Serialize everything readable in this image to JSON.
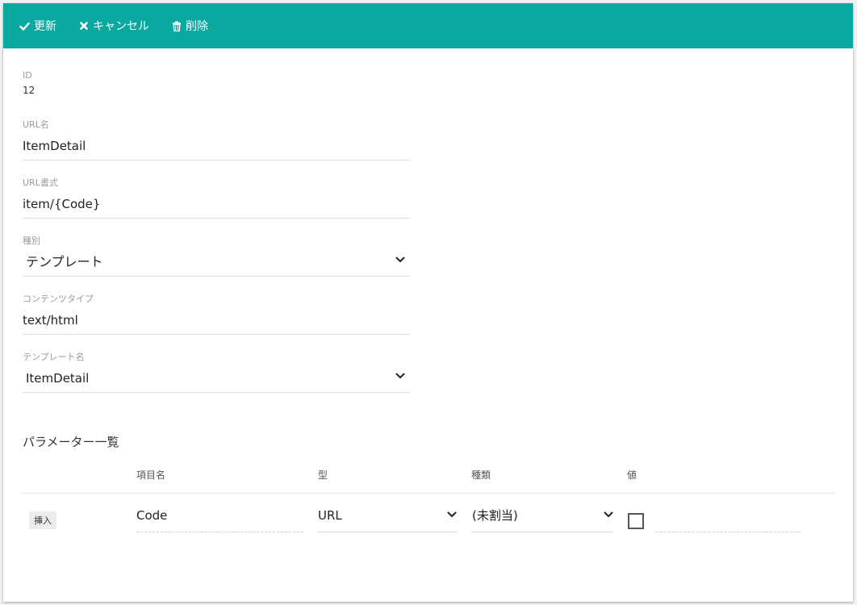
{
  "toolbar": {
    "update_label": "更新",
    "cancel_label": "キャンセル",
    "delete_label": "削除",
    "bg_color": "#0ba8a0"
  },
  "form": {
    "id_label": "ID",
    "id_value": "12",
    "url_name_label": "URL名",
    "url_name_value": "ItemDetail",
    "url_format_label": "URL書式",
    "url_format_value": "item/{Code}",
    "kind_label": "種別",
    "kind_value": "テンプレート",
    "content_type_label": "コンテンツタイプ",
    "content_type_value": "text/html",
    "template_name_label": "テンプレート名",
    "template_name_value": "ItemDetail"
  },
  "params": {
    "section_title": "パラメーター一覧",
    "headers": {
      "item_name": "項目名",
      "type": "型",
      "kind": "種類",
      "value": "値"
    },
    "rows": [
      {
        "insert_label": "挿入",
        "item_name": "Code",
        "type": "URL",
        "kind": "(未割当)",
        "checked": false,
        "value": ""
      }
    ]
  }
}
